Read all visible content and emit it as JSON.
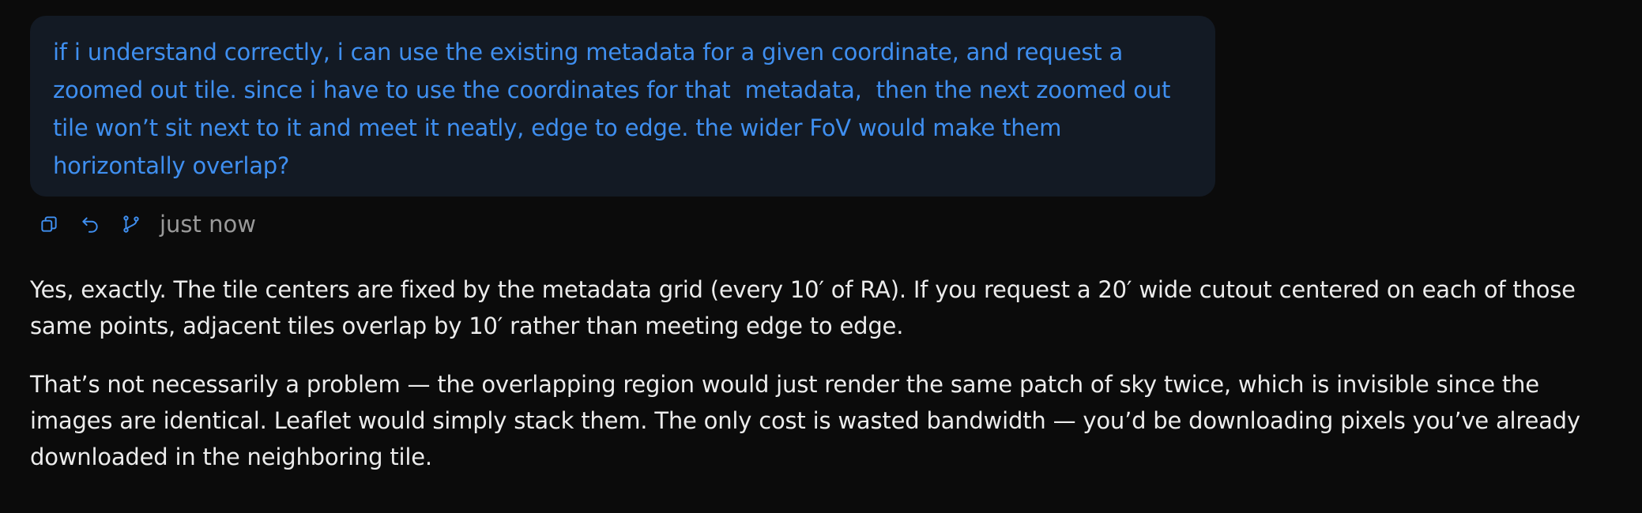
{
  "user_message": {
    "text": "if i understand correctly, i can use the existing metadata for a given coordinate, and request a\nzoomed out tile. since i have to use the coordinates for that  metadata,  then the next zoomed out\ntile won’t sit next to it and meet it neatly, edge to edge. the wider FoV would make them\nhorizontally overlap?"
  },
  "message_actions": {
    "icons": [
      "copy-icon",
      "undo-icon",
      "branch-icon"
    ],
    "timestamp": "just now"
  },
  "assistant_message": {
    "paragraphs": [
      "Yes, exactly. The tile centers are fixed by the metadata grid (every 10′ of RA). If you request a 20′ wide cutout centered on each of those same points, adjacent tiles overlap by 10′ rather than meeting edge to edge.",
      "That’s not necessarily a problem — the overlapping region would just render the same patch of sky twice, which is invisible since the images are identical. Leaflet would simply stack them. The only cost is wasted bandwidth — you’d be downloading pixels you’ve already downloaded in the neighboring tile."
    ]
  },
  "colors": {
    "background": "#0b0b0b",
    "user_bubble": "#131a24",
    "user_text": "#3f8ff0",
    "assistant_text": "#ececec",
    "timestamp": "#9a9a9a"
  }
}
